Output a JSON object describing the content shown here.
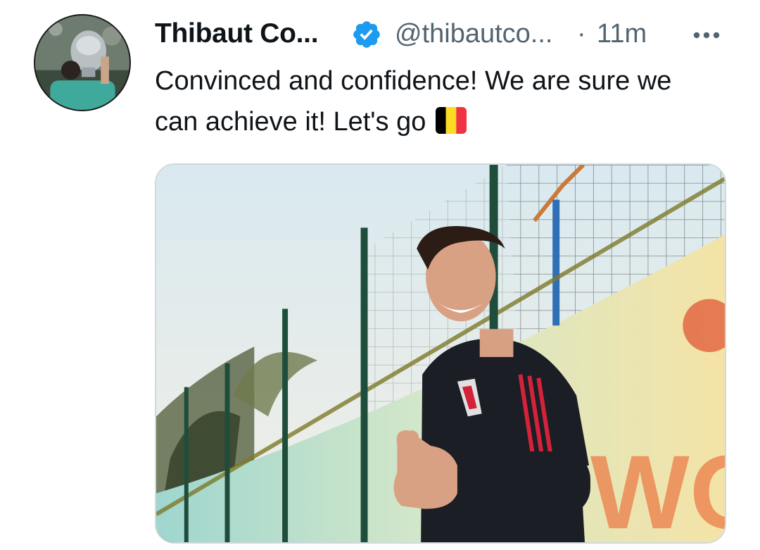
{
  "tweet": {
    "author_name": "Thibaut Co...",
    "handle": "@thibautco...",
    "separator": "·",
    "time": "11m",
    "line1": "Convinced and confidence! We are sure we",
    "line2": "can achieve it! Let's go",
    "flag_emoji": "belgium-flag"
  },
  "colors": {
    "verified": "#1d9bf0",
    "secondary_text": "#536471",
    "flag_black": "#000000",
    "flag_yellow": "#fdda24",
    "flag_red": "#ef3340"
  },
  "icons": {
    "verified": "verified-badge-icon",
    "more": "more-horizontal-icon"
  }
}
